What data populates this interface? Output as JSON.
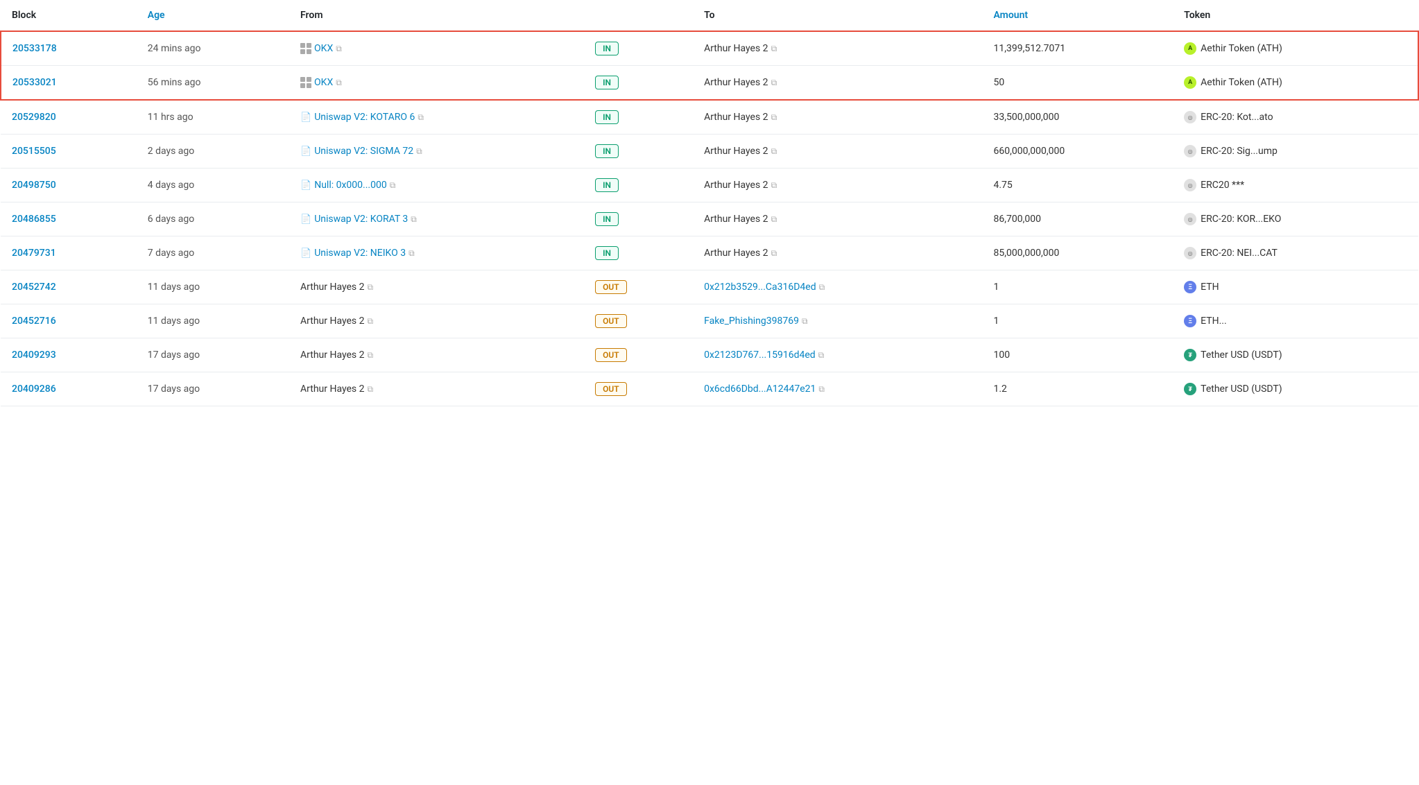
{
  "columns": [
    {
      "key": "block",
      "label": "Block",
      "sortable": false
    },
    {
      "key": "age",
      "label": "Age",
      "sortable": true
    },
    {
      "key": "from",
      "label": "From",
      "sortable": false
    },
    {
      "key": "direction",
      "label": "",
      "sortable": false
    },
    {
      "key": "to",
      "label": "To",
      "sortable": false
    },
    {
      "key": "amount",
      "label": "Amount",
      "sortable": true
    },
    {
      "key": "token",
      "label": "Token",
      "sortable": false
    }
  ],
  "rows": [
    {
      "id": 1,
      "block": "20533178",
      "age": "24 mins ago",
      "from": "OKX",
      "fromType": "okx",
      "fromLink": true,
      "direction": "IN",
      "to": "Arthur Hayes 2",
      "toLink": false,
      "amount": "11,399,512.7071",
      "tokenIcon": "ath",
      "token": "Aethir Token (ATH)",
      "highlight": "top"
    },
    {
      "id": 2,
      "block": "20533021",
      "age": "56 mins ago",
      "from": "OKX",
      "fromType": "okx",
      "fromLink": true,
      "direction": "IN",
      "to": "Arthur Hayes 2",
      "toLink": false,
      "amount": "50",
      "tokenIcon": "ath",
      "token": "Aethir Token (ATH)",
      "highlight": "bottom"
    },
    {
      "id": 3,
      "block": "20529820",
      "age": "11 hrs ago",
      "from": "Uniswap V2: KOTARO 6",
      "fromType": "uniswap",
      "fromLink": true,
      "direction": "IN",
      "to": "Arthur Hayes 2",
      "toLink": false,
      "amount": "33,500,000,000",
      "tokenIcon": "erc20",
      "token": "ERC-20: Kot...ato",
      "highlight": "none"
    },
    {
      "id": 4,
      "block": "20515505",
      "age": "2 days ago",
      "from": "Uniswap V2: SIGMA 72",
      "fromType": "uniswap",
      "fromLink": true,
      "direction": "IN",
      "to": "Arthur Hayes 2",
      "toLink": false,
      "amount": "660,000,000,000",
      "tokenIcon": "erc20",
      "token": "ERC-20: Sig...ump",
      "highlight": "none"
    },
    {
      "id": 5,
      "block": "20498750",
      "age": "4 days ago",
      "from": "Null: 0x000...000",
      "fromType": "null",
      "fromLink": true,
      "direction": "IN",
      "to": "Arthur Hayes 2",
      "toLink": false,
      "amount": "4.75",
      "tokenIcon": "erc20",
      "token": "ERC20 ***",
      "highlight": "none"
    },
    {
      "id": 6,
      "block": "20486855",
      "age": "6 days ago",
      "from": "Uniswap V2: KORAT 3",
      "fromType": "uniswap",
      "fromLink": true,
      "direction": "IN",
      "to": "Arthur Hayes 2",
      "toLink": false,
      "amount": "86,700,000",
      "tokenIcon": "erc20",
      "token": "ERC-20: KOR...EKO",
      "highlight": "none"
    },
    {
      "id": 7,
      "block": "20479731",
      "age": "7 days ago",
      "from": "Uniswap V2: NEIKO 3",
      "fromType": "uniswap",
      "fromLink": true,
      "direction": "IN",
      "to": "Arthur Hayes 2",
      "toLink": false,
      "amount": "85,000,000,000",
      "tokenIcon": "erc20",
      "token": "ERC-20: NEI...CAT",
      "highlight": "none"
    },
    {
      "id": 8,
      "block": "20452742",
      "age": "11 days ago",
      "from": "Arthur Hayes 2",
      "fromType": "label",
      "fromLink": false,
      "direction": "OUT",
      "to": "0x212b3529...Ca316D4ed",
      "toLink": true,
      "amount": "1",
      "tokenIcon": "eth",
      "token": "ETH",
      "highlight": "none"
    },
    {
      "id": 9,
      "block": "20452716",
      "age": "11 days ago",
      "from": "Arthur Hayes 2",
      "fromType": "label",
      "fromLink": false,
      "direction": "OUT",
      "to": "Fake_Phishing398769",
      "toLink": true,
      "amount": "1",
      "tokenIcon": "eth",
      "token": "ETH...",
      "highlight": "none"
    },
    {
      "id": 10,
      "block": "20409293",
      "age": "17 days ago",
      "from": "Arthur Hayes 2",
      "fromType": "label",
      "fromLink": false,
      "direction": "OUT",
      "to": "0x2123D767...15916d4ed",
      "toLink": true,
      "amount": "100",
      "tokenIcon": "usdt",
      "token": "Tether USD (USDT)",
      "highlight": "none"
    },
    {
      "id": 11,
      "block": "20409286",
      "age": "17 days ago",
      "from": "Arthur Hayes 2",
      "fromType": "label",
      "fromLink": false,
      "direction": "OUT",
      "to": "0x6cd66Dbd...A12447e21",
      "toLink": true,
      "amount": "1.2",
      "tokenIcon": "usdt",
      "token": "Tether USD (USDT)",
      "highlight": "none"
    }
  ],
  "copy_symbol": "⧉",
  "labels": {
    "block": "Block",
    "age": "Age",
    "from": "From",
    "to": "To",
    "amount": "Amount",
    "token": "Token"
  }
}
